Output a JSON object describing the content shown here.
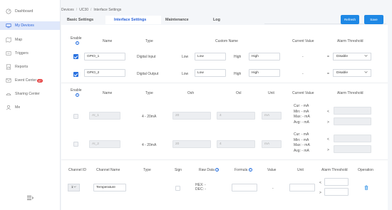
{
  "sidebar": {
    "items": [
      {
        "label": "Dashboard",
        "icon": "dashboard-icon"
      },
      {
        "label": "My Devices",
        "icon": "devices-icon"
      },
      {
        "label": "Map",
        "icon": "map-icon"
      },
      {
        "label": "Triggers",
        "icon": "triggers-icon"
      },
      {
        "label": "Reports",
        "icon": "reports-icon"
      },
      {
        "label": "Event Center",
        "icon": "event-center-icon",
        "badge": "87"
      },
      {
        "label": "Sharing Center",
        "icon": "sharing-icon"
      },
      {
        "label": "Me",
        "icon": "user-icon"
      }
    ],
    "active_index": 1
  },
  "breadcrumb": [
    "Devices",
    "UC30",
    "Interface Settings"
  ],
  "tabs": {
    "items": [
      "Basic Settings",
      "Interface Settings",
      "Maintenance",
      "Log"
    ],
    "active_index": 1
  },
  "actions": {
    "refresh": "Refresh",
    "save": "Save"
  },
  "accent_color": "#1e88e5",
  "gpio": {
    "headers": {
      "enable": "Enable",
      "name": "Name",
      "type": "Type",
      "custom_name": "Custom Name",
      "current_value": "Current Value",
      "alarm_threshold": "Alarm Threshold"
    },
    "rows": [
      {
        "enabled": true,
        "name": "GPIO_1",
        "type": "Digital Input",
        "low_label": "Low",
        "low_value": "Low",
        "high_label": "High",
        "high_value": "High",
        "current": "-",
        "op": "=",
        "alarm": "Disable"
      },
      {
        "enabled": true,
        "name": "GPIO_2",
        "type": "Digital Output",
        "low_label": "Low",
        "low_value": "Low",
        "high_label": "High",
        "high_value": "High",
        "current": "-",
        "op": "=",
        "alarm": "Disable"
      }
    ]
  },
  "analog": {
    "headers": {
      "enable": "Enable",
      "name": "Name",
      "type": "Type",
      "osh": "Osh",
      "osl": "Osl",
      "unit": "Unit",
      "current_value": "Current Value",
      "alarm_threshold": "Alarm Threshold"
    },
    "rows": [
      {
        "enabled": false,
        "name": "AI_1",
        "type": "4 - 20mA",
        "osh": "20",
        "osl": "4",
        "unit": "mA",
        "stats": [
          "Cur: - mA",
          "Min: - mA",
          "Max: - mA",
          "Avg: - mA"
        ],
        "op1": "<",
        "op2": ">"
      },
      {
        "enabled": false,
        "name": "AI_2",
        "type": "4 - 20mA",
        "osh": "20",
        "osl": "4",
        "unit": "mA",
        "stats": [
          "Cur: - mA",
          "Min: - mA",
          "Max: - mA",
          "Avg: - mA"
        ],
        "op1": "<",
        "op2": ">"
      }
    ]
  },
  "channel": {
    "headers": {
      "channel_id": "Channel ID",
      "channel_name": "Channel Name",
      "type": "Type",
      "sign": "Sign",
      "raw_data": "Raw Data",
      "formula": "Formula",
      "value": "Value",
      "unit": "Unit",
      "alarm_threshold": "Alarm Threshold",
      "operation": "Operation"
    },
    "row": {
      "id": "1",
      "name": "Temperature",
      "type": "",
      "raw_hex": "HEX: -",
      "raw_dec": "DEC: -",
      "value": "-",
      "op1": "<",
      "op2": ">"
    }
  }
}
